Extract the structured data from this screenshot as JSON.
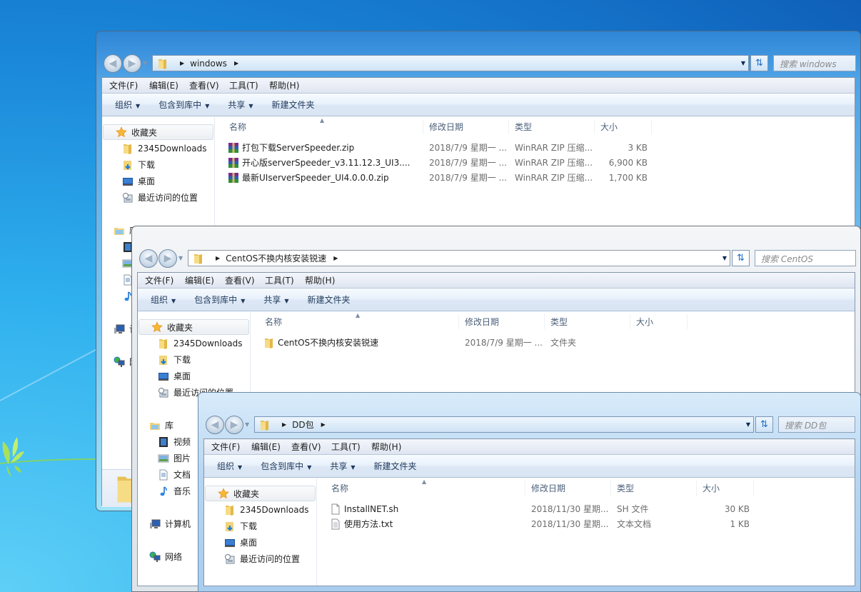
{
  "common": {
    "menu": [
      "文件(F)",
      "编辑(E)",
      "查看(V)",
      "工具(T)",
      "帮助(H)"
    ],
    "toolbar": [
      {
        "label": "组织",
        "caret": true
      },
      {
        "label": "包含到库中",
        "caret": true
      },
      {
        "label": "共享",
        "caret": true
      },
      {
        "label": "新建文件夹",
        "caret": false
      }
    ],
    "columns": [
      "名称",
      "修改日期",
      "类型",
      "大小"
    ],
    "nav": {
      "favorites": "收藏夹",
      "favorite_items": [
        {
          "label": "2345Downloads",
          "icon": "folder-icon"
        },
        {
          "label": "下载",
          "icon": "downloads-folder-icon"
        },
        {
          "label": "桌面",
          "icon": "desktop-icon"
        },
        {
          "label": "最近访问的位置",
          "icon": "recent-places-icon"
        }
      ],
      "libraries": "库",
      "library_items": [
        {
          "label": "视频",
          "icon": "video-icon"
        },
        {
          "label": "图片",
          "icon": "pictures-icon"
        },
        {
          "label": "文档",
          "icon": "documents-icon"
        },
        {
          "label": "音乐",
          "icon": "music-icon"
        }
      ],
      "computer": "计算机",
      "network": "网络"
    }
  },
  "windows": [
    {
      "path": "windows",
      "search_placeholder": "搜索 windows",
      "files": [
        {
          "name": "打包下载ServerSpeeder.zip",
          "date": "2018/7/9 星期一 ...",
          "type": "WinRAR ZIP 压缩...",
          "size": "3 KB",
          "icon": "zip"
        },
        {
          "name": "开心版serverSpeeder_v3.11.12.3_UI3....",
          "date": "2018/7/9 星期一 ...",
          "type": "WinRAR ZIP 压缩...",
          "size": "6,900 KB",
          "icon": "zip"
        },
        {
          "name": "最新UIserverSpeeder_UI4.0.0.0.zip",
          "date": "2018/7/9 星期一 ...",
          "type": "WinRAR ZIP 压缩...",
          "size": "1,700 KB",
          "icon": "zip"
        }
      ]
    },
    {
      "path": "CentOS不换内核安装锐速",
      "search_placeholder": "搜索 CentOS",
      "files": [
        {
          "name": "CentOS不换内核安装锐速",
          "date": "2018/7/9 星期一 ...",
          "type": "文件夹",
          "size": "",
          "icon": "folder"
        }
      ]
    },
    {
      "path": "DD包",
      "search_placeholder": "搜索 DD包",
      "files": [
        {
          "name": "InstallNET.sh",
          "date": "2018/11/30 星期...",
          "type": "SH 文件",
          "size": "30 KB",
          "icon": "file"
        },
        {
          "name": "使用方法.txt",
          "date": "2018/11/30 星期...",
          "type": "文本文档",
          "size": "1 KB",
          "icon": "text"
        }
      ]
    }
  ]
}
